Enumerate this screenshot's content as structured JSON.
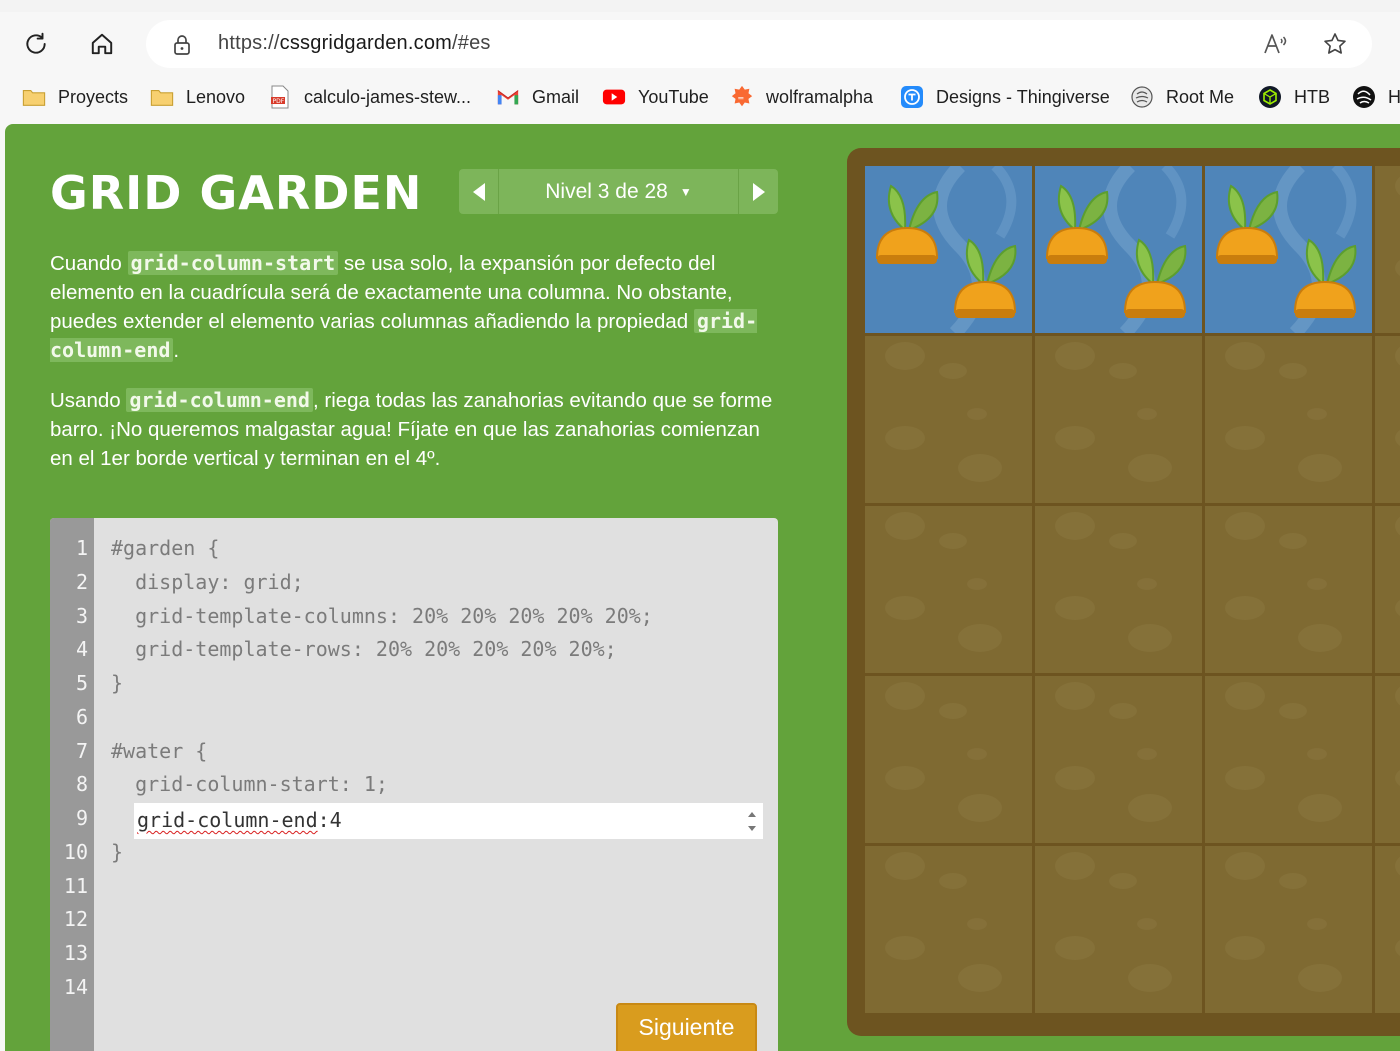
{
  "browser": {
    "url_prefix": "https://",
    "url_host": "cssgridgarden.com",
    "url_suffix": "/#es",
    "bookmarks": [
      {
        "label": "Proyects",
        "icon": "folder-icon"
      },
      {
        "label": "Lenovo",
        "icon": "folder-icon"
      },
      {
        "label": "calculo-james-stew...",
        "icon": "pdf-icon"
      },
      {
        "label": "Gmail",
        "icon": "gmail-icon"
      },
      {
        "label": "YouTube",
        "icon": "youtube-icon"
      },
      {
        "label": "wolframalpha",
        "icon": "wolframalpha-icon"
      },
      {
        "label": "Designs - Thingiverse",
        "icon": "thingiverse-icon"
      },
      {
        "label": "Root Me",
        "icon": "rootme-icon"
      },
      {
        "label": "HTB",
        "icon": "htb-icon"
      },
      {
        "label": "H",
        "icon": "globe-icon"
      }
    ]
  },
  "game": {
    "title": "GRID GARDEN",
    "level_label": "Nivel 3 de 28",
    "instructions": {
      "p1_a": "Cuando ",
      "p1_code1": "grid-column-start",
      "p1_b": " se usa solo, la expansión por defecto del elemento en la cuadrícula será de exactamente una columna. No obstante, puedes extender el elemento varias columnas añadiendo la propiedad ",
      "p1_code2": "grid-column-end",
      "p1_c": ".",
      "p2_a": "Usando ",
      "p2_code": "grid-column-end",
      "p2_b": ", riega todas las zanahorias evitando que se forme barro. ¡No queremos malgastar agua! Fíjate en que las zanahorias comienzan en el 1er borde vertical y terminan en el 4º."
    },
    "editor": {
      "line_numbers": [
        "1",
        "2",
        "3",
        "4",
        "5",
        "6",
        "7",
        "8",
        "9",
        "10",
        "11",
        "12",
        "13",
        "14"
      ],
      "lines": {
        "l1": "#garden {",
        "l2": "  display: grid;",
        "l3": "  grid-template-columns: 20% 20% 20% 20% 20%;",
        "l4": "  grid-template-rows: 20% 20% 20% 20% 20%;",
        "l5": "}",
        "l7": "#water {",
        "l8": "  grid-column-start: 1;",
        "l10": "}"
      },
      "input_property": "grid-column-end",
      "input_value": ":4"
    },
    "next_button": "Siguiente",
    "garden": {
      "watered_columns": 3,
      "carrot_row": 1,
      "colors": {
        "water": "#4f85b9",
        "soil": "#7f6a32",
        "frame": "#6d5420",
        "page_bg": "#63a33b"
      }
    }
  }
}
